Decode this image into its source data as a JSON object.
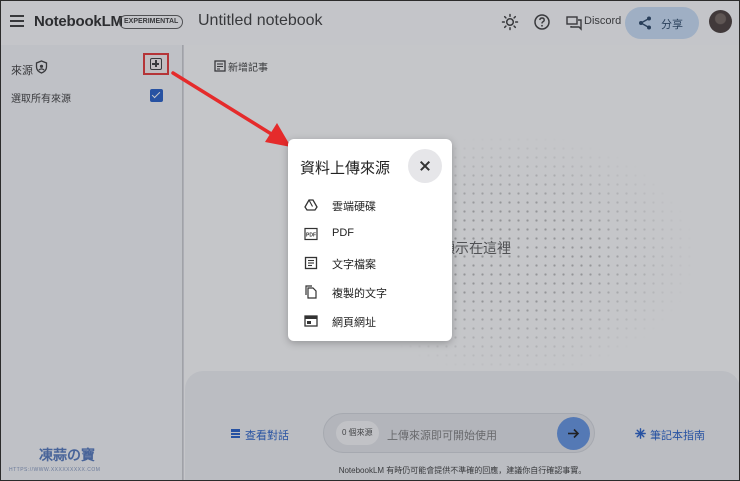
{
  "header": {
    "brand": "NotebookLM",
    "badge": "EXPERIMENTAL",
    "notebook_title": "Untitled notebook",
    "discord_label": "Discord",
    "share_label": "分享"
  },
  "sidebar": {
    "sources_label": "來源",
    "select_all_label": "選取所有來源"
  },
  "main": {
    "new_note_label": "新增記事",
    "empty_hint": "事會顯示在這裡",
    "view_chat_label": "查看對話",
    "source_count": "0 個來源",
    "chat_placeholder": "上傳來源即可開始使用",
    "guide_label": "筆記本指南",
    "disclaimer": "NotebookLM 有時仍可能會提供不準確的回應，建議你自行確認事實。"
  },
  "dialog": {
    "title": "資料上傳來源",
    "options": [
      {
        "label": "雲端硬碟",
        "icon": "drive-icon"
      },
      {
        "label": "PDF",
        "icon": "pdf-icon"
      },
      {
        "label": "文字檔案",
        "icon": "text-file-icon"
      },
      {
        "label": "複製的文字",
        "icon": "copy-text-icon"
      },
      {
        "label": "網頁網址",
        "icon": "web-url-icon"
      }
    ]
  },
  "watermark": {
    "text": "凍蒜の寶",
    "sub": "HTTPS://WWW.XXXXXXXXX.COM"
  },
  "colors": {
    "accent": "#1a56c4",
    "annotation_red": "#e52b2b",
    "share_bg": "#c6dcf5"
  }
}
